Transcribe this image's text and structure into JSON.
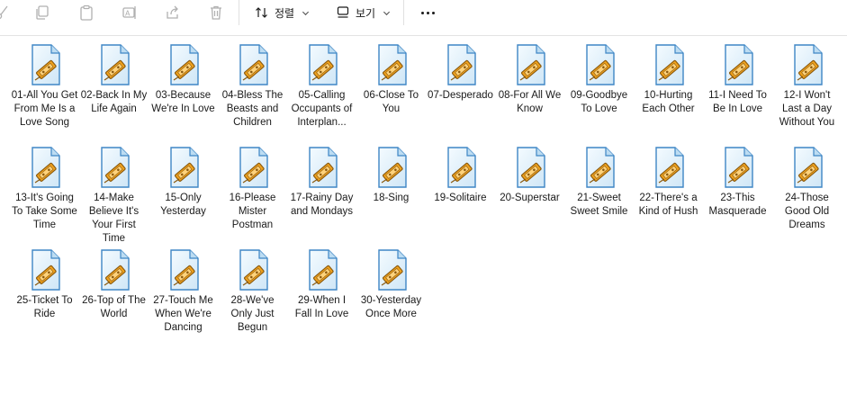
{
  "toolbar": {
    "sort_label": "정렬",
    "view_label": "보기"
  },
  "icons": {
    "file": "audio-file-icon",
    "cut": "cut-icon",
    "copy": "copy-icon",
    "paste": "paste-icon",
    "rename": "rename-icon",
    "share": "share-icon",
    "delete": "delete-icon",
    "sort": "sort-icon",
    "view": "view-icon",
    "more": "more-icon"
  },
  "colors": {
    "icon_paper": "#e6f3fb",
    "icon_border": "#3e86c5",
    "icon_accent": "#f0a21d"
  },
  "files": [
    {
      "name": "01-All You Get From Me Is a Love Song"
    },
    {
      "name": "02-Back In My Life Again"
    },
    {
      "name": "03-Because We're In Love"
    },
    {
      "name": "04-Bless The Beasts and Children"
    },
    {
      "name": "05-Calling Occupants of Interplan..."
    },
    {
      "name": "06-Close To You"
    },
    {
      "name": "07-Desperado"
    },
    {
      "name": "08-For All We Know"
    },
    {
      "name": "09-Goodbye To Love"
    },
    {
      "name": "10-Hurting Each Other"
    },
    {
      "name": "11-I Need To Be In Love"
    },
    {
      "name": "12-I Won't Last a Day Without You"
    },
    {
      "name": "13-It's Going To Take Some Time"
    },
    {
      "name": "14-Make Believe It's Your First Time"
    },
    {
      "name": "15-Only Yesterday"
    },
    {
      "name": "16-Please Mister Postman"
    },
    {
      "name": "17-Rainy Day and Mondays"
    },
    {
      "name": "18-Sing"
    },
    {
      "name": "19-Solitaire"
    },
    {
      "name": "20-Superstar"
    },
    {
      "name": "21-Sweet Sweet Smile"
    },
    {
      "name": "22-There's a Kind of Hush"
    },
    {
      "name": "23-This Masquerade"
    },
    {
      "name": "24-Those Good Old Dreams"
    },
    {
      "name": "25-Ticket To Ride"
    },
    {
      "name": "26-Top of The World"
    },
    {
      "name": "27-Touch Me When We're Dancing"
    },
    {
      "name": "28-We've Only Just Begun"
    },
    {
      "name": "29-When I Fall In Love"
    },
    {
      "name": "30-Yesterday Once More"
    }
  ]
}
